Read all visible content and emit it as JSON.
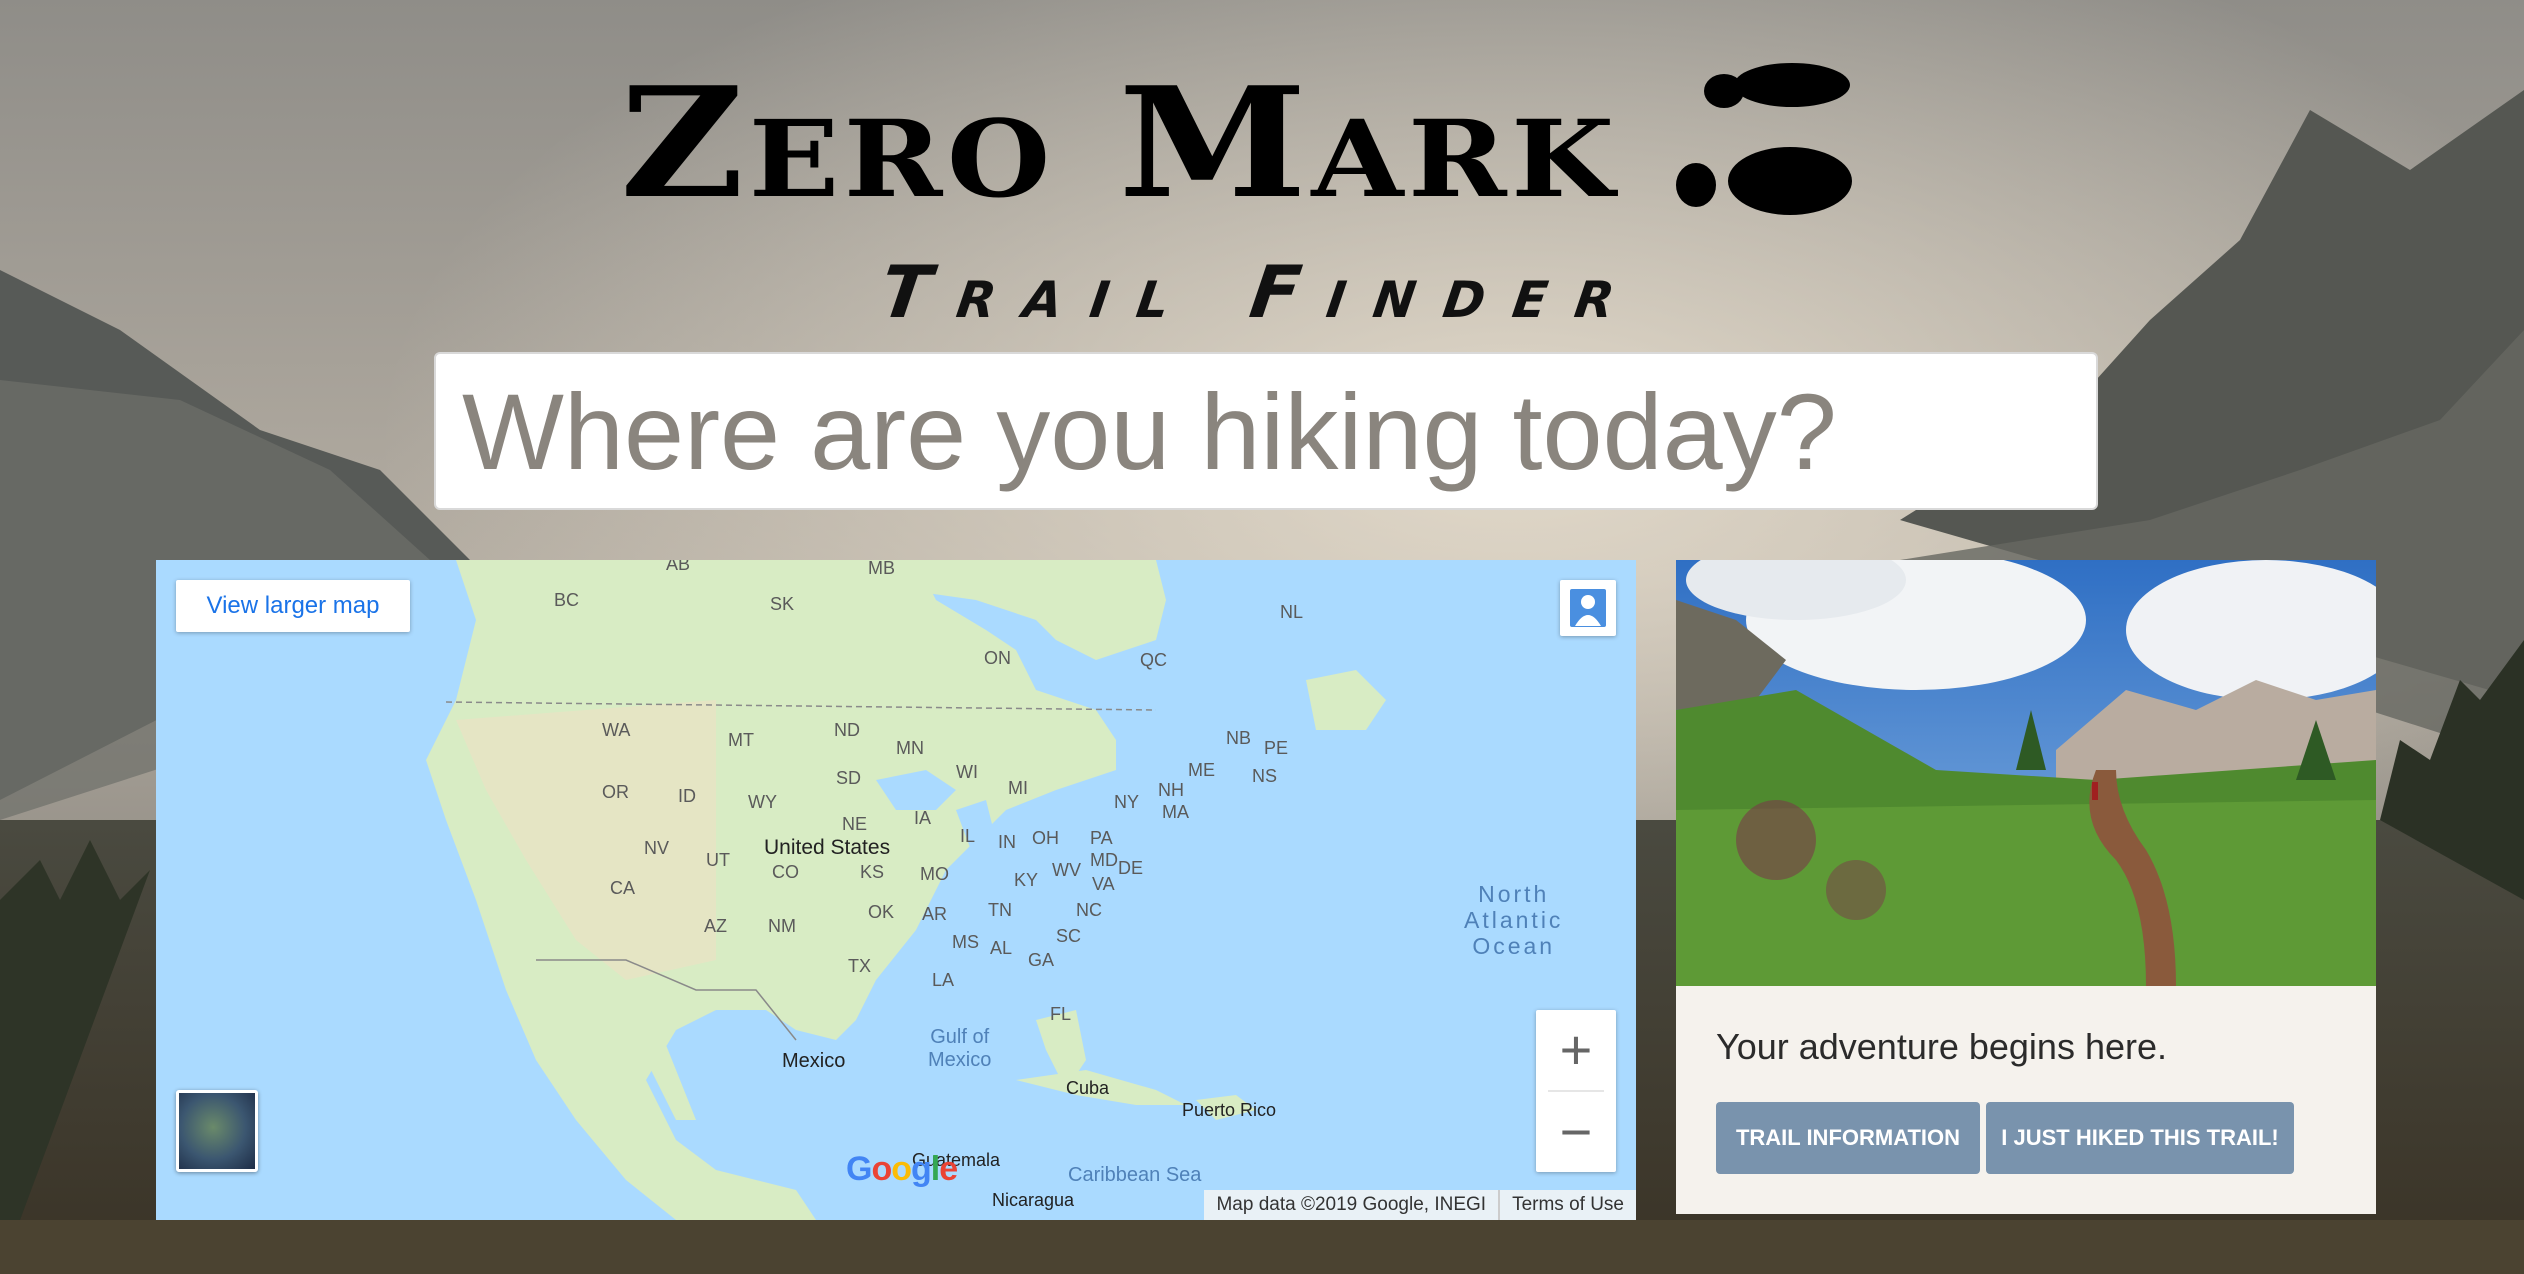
{
  "header": {
    "title": "Zero Mark",
    "subtitle": "Trail Finder",
    "logo_icon": "footprints-icon"
  },
  "search": {
    "placeholder": "Where are you hiking today?",
    "value": ""
  },
  "map": {
    "larger_map_label": "View larger map",
    "zoom_in": "+",
    "zoom_out": "−",
    "attribution": "Map data ©2019 Google, INEGI",
    "terms": "Terms of Use",
    "logo": "Google",
    "labels": {
      "united_states": "United States",
      "mexico": "Mexico",
      "cuba": "Cuba",
      "puerto_rico": "Puerto Rico",
      "guatemala": "Guatemala",
      "nicaragua": "Nicaragua",
      "gulf_line1": "Gulf of",
      "gulf_line2": "Mexico",
      "caribbean": "Caribbean Sea",
      "ocean_line1": "North",
      "ocean_line2": "Atlantic",
      "ocean_line3": "Ocean",
      "ab": "AB",
      "mb": "MB",
      "bc": "BC",
      "sk": "SK",
      "on": "ON",
      "qc": "QC",
      "nl": "NL",
      "nb": "NB",
      "pe": "PE",
      "ns": "NS",
      "wa": "WA",
      "mt": "MT",
      "nd": "ND",
      "mn": "MN",
      "wi": "WI",
      "mi": "MI",
      "me": "ME",
      "nh": "NH",
      "ma": "MA",
      "ny": "NY",
      "or": "OR",
      "id": "ID",
      "wy": "WY",
      "sd": "SD",
      "ne": "NE",
      "ia": "IA",
      "il": "IL",
      "in": "IN",
      "oh": "OH",
      "pa": "PA",
      "md": "MD",
      "de": "DE",
      "nv": "NV",
      "ut": "UT",
      "co": "CO",
      "ks": "KS",
      "mo": "MO",
      "ky": "KY",
      "wv": "WV",
      "va": "VA",
      "ca": "CA",
      "az": "AZ",
      "nm": "NM",
      "ok": "OK",
      "ar": "AR",
      "tn": "TN",
      "nc": "NC",
      "sc": "SC",
      "ms": "MS",
      "al": "AL",
      "ga": "GA",
      "tx": "TX",
      "la": "LA",
      "fl": "FL"
    }
  },
  "card": {
    "tagline": "Your adventure begins here.",
    "info_button": "TRAIL INFORMATION",
    "hiked_button": "I JUST HIKED THIS TRAIL!"
  },
  "colors": {
    "button_bg": "#7993ad",
    "card_bg": "#f5f2ed",
    "map_water": "#aadaff",
    "map_land": "#d8ecc4",
    "link": "#1a73e8"
  }
}
